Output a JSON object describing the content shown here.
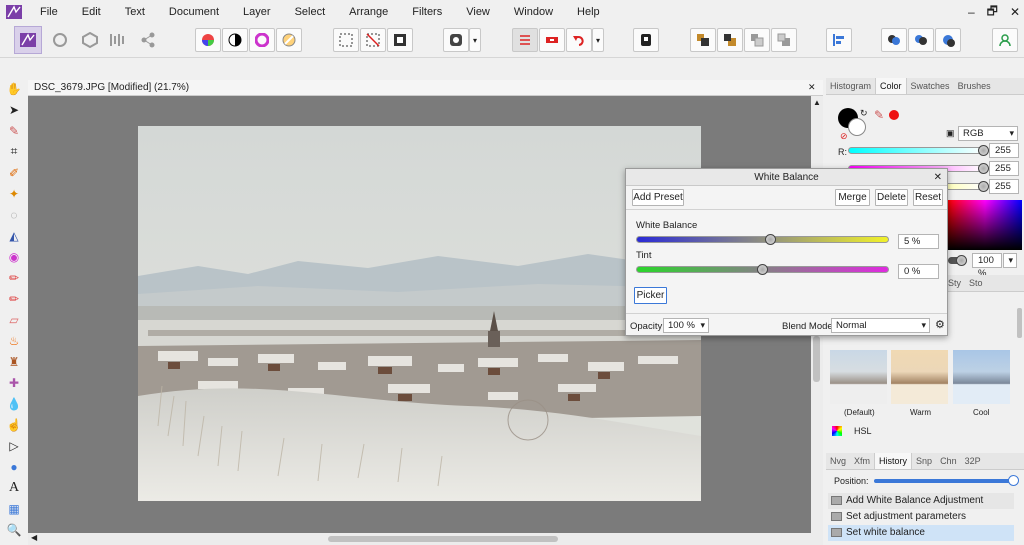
{
  "menu": [
    "File",
    "Edit",
    "Text",
    "Document",
    "Layer",
    "Select",
    "Arrange",
    "Filters",
    "View",
    "Window",
    "Help"
  ],
  "window_controls": {
    "minimize": "‒",
    "restore": "🗗",
    "close": "✕"
  },
  "document": {
    "tab_title": "DSC_3679.JPG [Modified] (21.7%)",
    "close_glyph": "✕"
  },
  "white_balance": {
    "title": "White Balance",
    "close_glyph": "✕",
    "add_preset": "Add Preset",
    "merge": "Merge",
    "delete": "Delete",
    "reset": "Reset",
    "wb_label": "White Balance",
    "wb_value": "5 %",
    "wb_level_fraction": 0.53,
    "tint_label": "Tint",
    "tint_value": "0 %",
    "tint_level_fraction": 0.5,
    "picker": "Picker",
    "opacity_label": "Opacity:",
    "opacity_value": "100 %",
    "blend_label": "Blend Mode:",
    "blend_value": "Normal"
  },
  "color_panel": {
    "tabs": [
      "Histogram",
      "Color",
      "Swatches",
      "Brushes"
    ],
    "active_tab": "Color",
    "model": "RGB",
    "r_label": "R:",
    "r": "255",
    "g": "255",
    "b": "255",
    "opacity": "100 %"
  },
  "adjust_panel": {
    "tabs": [
      "Sty",
      "Sto"
    ],
    "presets": [
      "(Default)",
      "Warm",
      "Cool"
    ],
    "item": "HSL"
  },
  "history_panel": {
    "tabs": [
      "Nvg",
      "Xfm",
      "History",
      "Snp",
      "Chn",
      "32P"
    ],
    "active_tab": "History",
    "position_label": "Position:",
    "entries": [
      "Add White Balance Adjustment",
      "Set adjustment parameters",
      "Set white balance"
    ],
    "selected_index": 2
  },
  "colors": {
    "accent": "#3b78d8",
    "selected_row": "#cfe3f7"
  }
}
